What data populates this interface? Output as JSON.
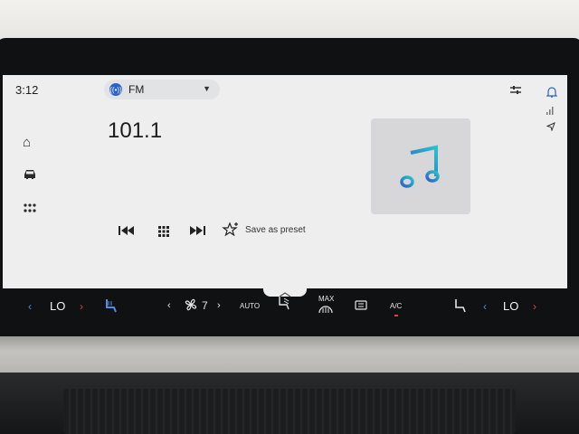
{
  "status": {
    "time": "3:12"
  },
  "source": {
    "label": "FM"
  },
  "radio": {
    "frequency": "101.1",
    "save_preset_label": "Save as preset"
  },
  "climate": {
    "left_temp": "LO",
    "right_temp": "LO",
    "fan_speed": "7",
    "auto_label": "AUTO",
    "max_label": "MAX",
    "ac_label": "A/C"
  },
  "icons": {
    "home": "home-icon",
    "car": "car-icon",
    "apps": "apps-icon",
    "prev": "skip-previous-icon",
    "keypad": "keypad-icon",
    "next": "skip-next-icon",
    "star": "star-add-icon",
    "settings": "equalizer-icon",
    "bell": "bell-icon",
    "nav": "navigation-icon",
    "music": "music-note-icon"
  },
  "colors": {
    "accent": "#2b62c9",
    "music_gradient_start": "#2b8ce0",
    "music_gradient_end": "#27c2c9"
  }
}
